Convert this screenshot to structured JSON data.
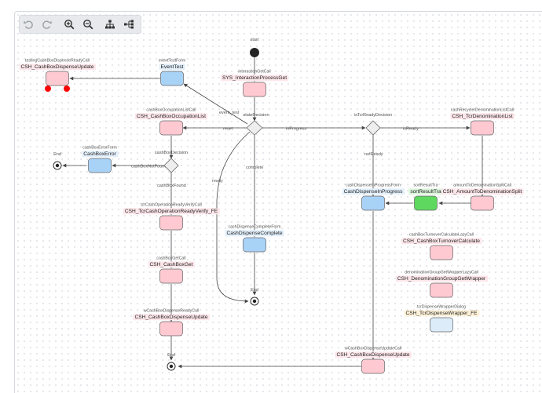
{
  "toolbar": {
    "buttons": [
      {
        "name": "undo-button",
        "icon": "undo-icon",
        "enabled": false
      },
      {
        "name": "redo-button",
        "icon": "redo-icon",
        "enabled": false
      },
      {
        "name": "zoom-in-button",
        "icon": "zoom-in-icon",
        "enabled": true
      },
      {
        "name": "zoom-out-button",
        "icon": "zoom-out-icon",
        "enabled": true
      },
      {
        "name": "layout-tree-button",
        "icon": "hierarchy-icon",
        "enabled": true
      },
      {
        "name": "layout-horizontal-button",
        "icon": "flow-horizontal-icon",
        "enabled": true
      }
    ]
  },
  "colors": {
    "call_state": "#ffc9d2",
    "call_label_bg": "#fde7eb",
    "form_state": "#a9d2f7",
    "form_label_bg": "#e3f0fc",
    "wrapper_state": "#dcecf8",
    "wrapper_label_bg": "#fff2d9",
    "sort_state": "#5fd85f",
    "sort_label_bg": "#dcf5dc",
    "edge": "#444444",
    "breakpoint": "#ff0000"
  },
  "diagram": {
    "start_label": "start",
    "end_label": "End",
    "nodes": {
      "interactionGetCall": {
        "small": "interactionGetCall",
        "name": "SYS_InteractionProcessGet"
      },
      "eventTestForm": {
        "small": "eventTestForm",
        "name": "EventTest"
      },
      "testingCall": {
        "small": "testingCashBoxDispenseReadyCall",
        "name": "CSH_CashBoxDispenseUpdate"
      },
      "occupationCall": {
        "small": "cashBoxOccupationListCall",
        "name": "CSH_CashBoxOccupationList"
      },
      "errorForm": {
        "small": "cashBoxErrorForm",
        "name": "CashBoxError"
      },
      "readyVerifyCall": {
        "small": "tcrCashOperationReadyVerifyCall",
        "name": "CSH_TcrCashOperationReadyVerify_FE"
      },
      "cashBoxGetCall": {
        "small": "cashBoxGetCall",
        "name": "CSH_CashBoxGet"
      },
      "dispenseReadyCall": {
        "small": "wCashBoxDispenseReadyCall",
        "name": "CSH_CashBoxDispenseUpdate"
      },
      "completeForm": {
        "small": "cashDispenseCompleteForm",
        "name": "CashDispenseComplete"
      },
      "inProgressForm": {
        "small": "cashDispenseInProgressForm",
        "name": "CashDispenseInProgress"
      },
      "sortResult": {
        "small": "sortResultTra",
        "name": "sortResultTra"
      },
      "denomSplitCall": {
        "small": "amountToDenominationSplitCall",
        "name": "CSH_AmountToDenominationSplit"
      },
      "recyclerCall": {
        "small": "cashRecyclerDenominationListCall",
        "name": "CSH_TcrDenominationList"
      },
      "turnoverCall": {
        "small": "cashBoxTurnoverCalculateLazyCall",
        "name": "CSH_CashBoxTurnoverCalculate"
      },
      "denomGroupCall": {
        "small": "denominationGroupGetWrapperLazyCall",
        "name": "CSH_DenominationGroupGetWrapper"
      },
      "wrapperDialog": {
        "small": "tcrDispenseWrapperDialog",
        "name": "CSH_TcrDispenseWrapper_FE"
      },
      "updateCall": {
        "small": "wCashBoxDispenseUpdateCall",
        "name": "CSH_CashBoxDispenseUpdate"
      }
    },
    "decisions": {
      "stateDecision": "stateDecision",
      "isTcrReadyDecision": "isTcrReadyDecision",
      "cashBoxDecision": "cashBoxDecision"
    },
    "edges": {
      "event_test": "event_test",
      "reset": "reset",
      "inProgress": "inProgress",
      "ready": "ready",
      "complete": "complete",
      "isReady": "isReady",
      "notReady": "notReady",
      "cashBoxNotFound": "cashBoxNotFound",
      "cashBoxFound": "cashBoxFound"
    }
  }
}
